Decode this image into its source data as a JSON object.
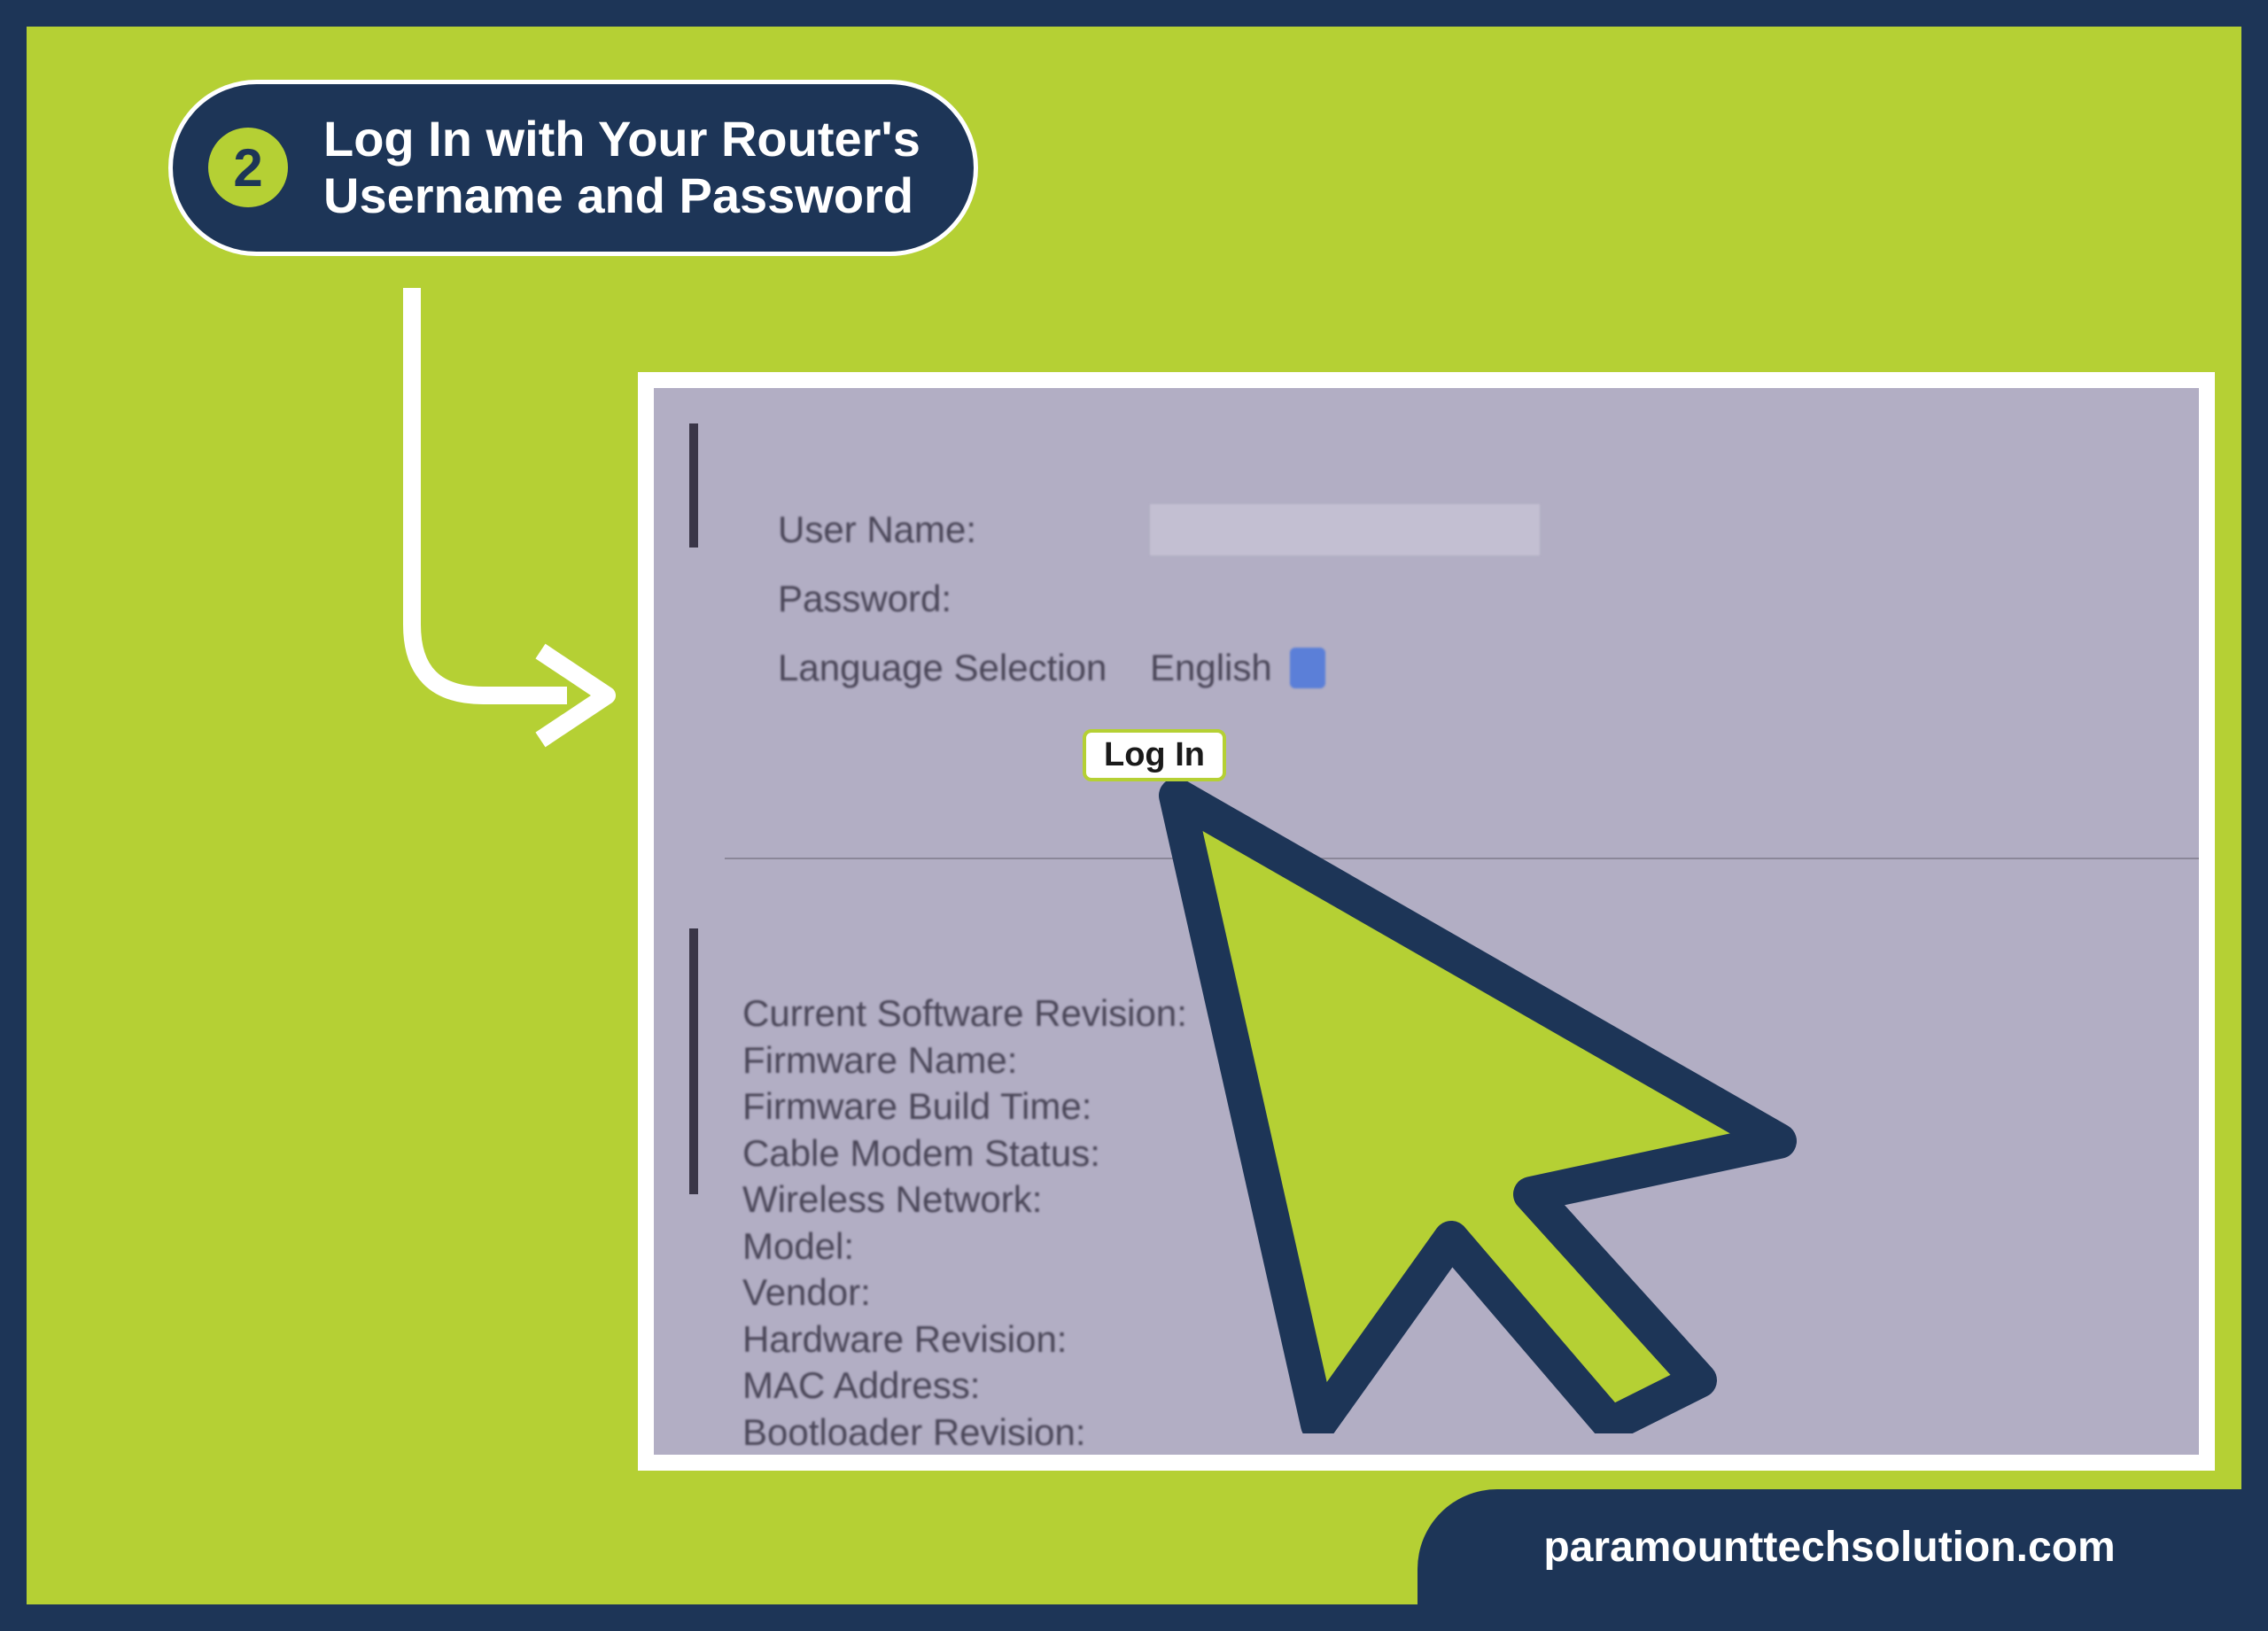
{
  "step": {
    "number": "2",
    "title_line1": "Log In with Your Router's",
    "title_line2": "Username and Password"
  },
  "router_form": {
    "username_label": "User Name:",
    "password_label": "Password:",
    "language_label": "Language Selection",
    "language_value": "English",
    "login_button": "Log In"
  },
  "router_info": {
    "items": [
      "Current Software Revision:",
      "Firmware Name:",
      "Firmware Build Time:",
      "Cable Modem Status:",
      "Wireless Network:",
      "Model:",
      "Vendor:",
      "Hardware Revision:",
      "MAC Address:",
      "Bootloader Revision:"
    ]
  },
  "footer": {
    "domain": "paramounttechsolution.com"
  }
}
